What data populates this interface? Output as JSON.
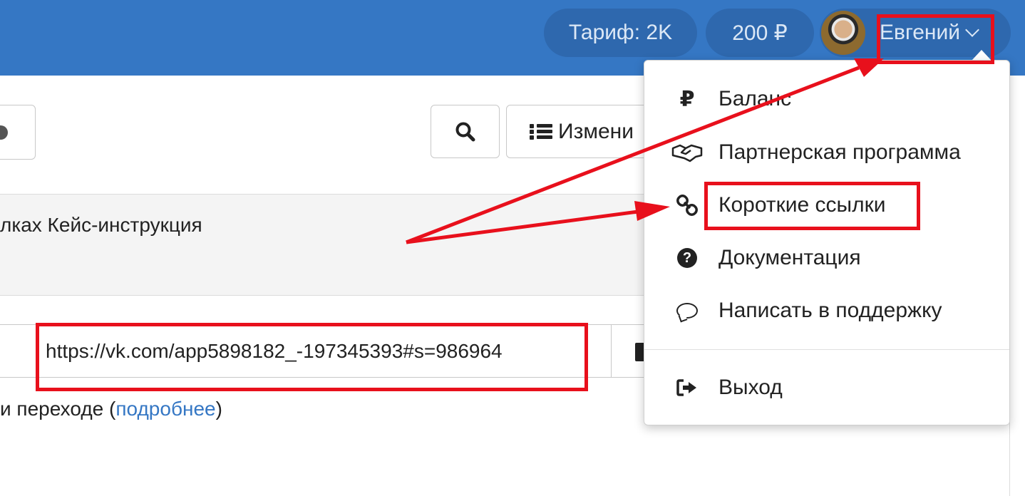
{
  "header": {
    "tariff_label": "Тариф: 2K",
    "balance_label": "200 ₽",
    "user_name": "Евгений"
  },
  "toolbar": {
    "change_label": "Измени"
  },
  "band": {
    "text": "лках Кейс-инструкция"
  },
  "link_field": {
    "value": "https://vk.com/app5898182_-197345393#s=986964"
  },
  "hint": {
    "prefix": "и переходе (",
    "link": "подробнее",
    "suffix": ")"
  },
  "dropdown": {
    "items": [
      {
        "label": "Баланс",
        "icon": "ruble-icon"
      },
      {
        "label": "Партнерская программа",
        "icon": "handshake-icon"
      },
      {
        "label": "Короткие ссылки",
        "icon": "link-icon"
      },
      {
        "label": "Документация",
        "icon": "question-circle-icon"
      },
      {
        "label": "Написать в поддержку",
        "icon": "comment-icon"
      },
      {
        "label": "Выход",
        "icon": "sign-out-icon"
      }
    ]
  },
  "colors": {
    "header_bg": "#3577c4",
    "annotation": "#e8101c",
    "link": "#3577c4"
  }
}
